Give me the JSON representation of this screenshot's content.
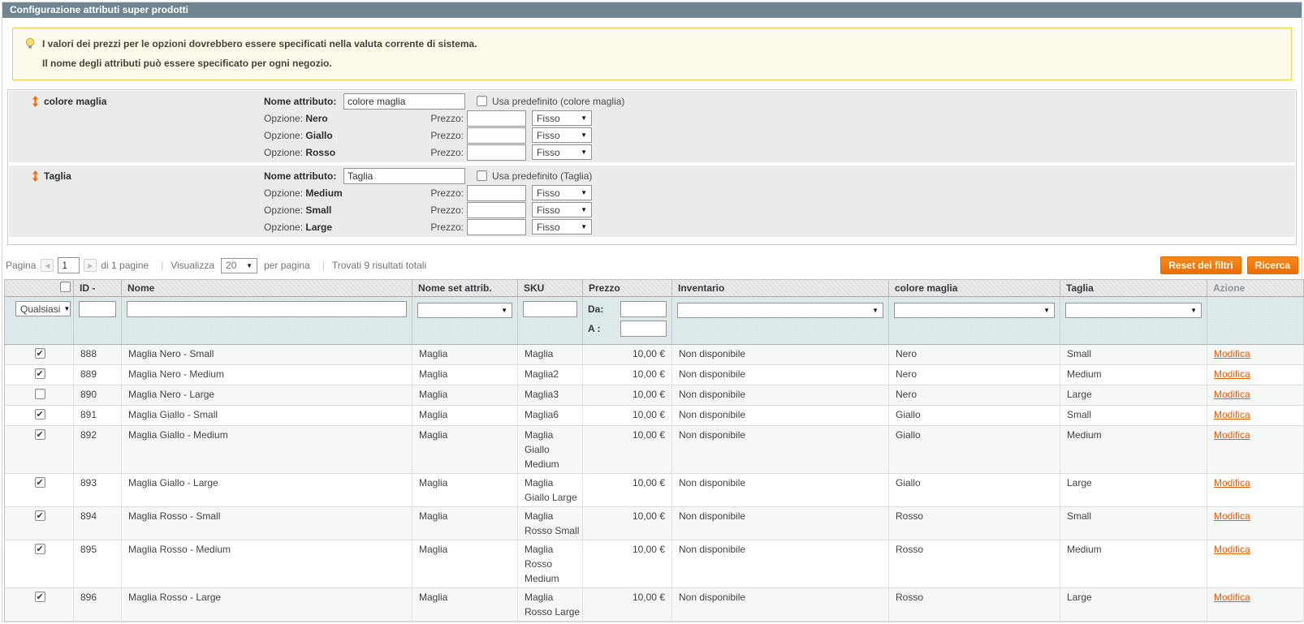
{
  "title": "Configurazione attributi super prodotti",
  "notice": {
    "line1": "I valori dei prezzi per le opzioni dovrebbero essere specificati nella valuta corrente di sistema.",
    "line2": "Il nome degli attributi può essere specificato per ogni negozio."
  },
  "attributes": [
    {
      "label": "colore maglia",
      "name_label": "Nome attributo:",
      "name_value": "colore maglia",
      "use_default_label": "Usa predefinito (colore maglia)",
      "use_default_checked": false,
      "option_label": "Opzione:",
      "price_label": "Prezzo:",
      "options": [
        {
          "name": "Nero",
          "price": "",
          "price_type": "Fisso"
        },
        {
          "name": "Giallo",
          "price": "",
          "price_type": "Fisso"
        },
        {
          "name": "Rosso",
          "price": "",
          "price_type": "Fisso"
        }
      ]
    },
    {
      "label": "Taglia",
      "name_label": "Nome attributo:",
      "name_value": "Taglia",
      "use_default_label": "Usa predefinito (Taglia)",
      "use_default_checked": false,
      "option_label": "Opzione:",
      "price_label": "Prezzo:",
      "options": [
        {
          "name": "Medium",
          "price": "",
          "price_type": "Fisso"
        },
        {
          "name": "Small",
          "price": "",
          "price_type": "Fisso"
        },
        {
          "name": "Large",
          "price": "",
          "price_type": "Fisso"
        }
      ]
    }
  ],
  "toolbar": {
    "page_label": "Pagina",
    "page_value": "1",
    "pages_total_label": "di 1 pagine",
    "view_label": "Visualizza",
    "per_page_value": "20",
    "per_page_label": "per pagina",
    "results_label": "Trovati 9 risultati totali",
    "reset_button": "Reset dei filtri",
    "search_button": "Ricerca"
  },
  "grid": {
    "columns": [
      "",
      "ID -",
      "Nome",
      "Nome set attrib.",
      "SKU",
      "Prezzo",
      "Inventario",
      "colore maglia",
      "Taglia",
      "Azione"
    ],
    "filters": {
      "massaction_value": "Qualsiasi",
      "price_from_label": "Da:",
      "price_to_label": "A :"
    },
    "rows": [
      {
        "checked": true,
        "id": "888",
        "nome": "Maglia Nero - Small",
        "set": "Maglia",
        "sku": "Maglia",
        "prezzo": "10,00 €",
        "inventario": "Non disponibile",
        "colore": "Nero",
        "taglia": "Small",
        "azione": "Modifica"
      },
      {
        "checked": true,
        "id": "889",
        "nome": "Maglia Nero - Medium",
        "set": "Maglia",
        "sku": "Maglia2",
        "prezzo": "10,00 €",
        "inventario": "Non disponibile",
        "colore": "Nero",
        "taglia": "Medium",
        "azione": "Modifica"
      },
      {
        "checked": false,
        "id": "890",
        "nome": "Maglia Nero - Large",
        "set": "Maglia",
        "sku": "Maglia3",
        "prezzo": "10,00 €",
        "inventario": "Non disponibile",
        "colore": "Nero",
        "taglia": "Large",
        "azione": "Modifica"
      },
      {
        "checked": true,
        "id": "891",
        "nome": "Maglia Giallo - Small",
        "set": "Maglia",
        "sku": "Maglia6",
        "prezzo": "10,00 €",
        "inventario": "Non disponibile",
        "colore": "Giallo",
        "taglia": "Small",
        "azione": "Modifica"
      },
      {
        "checked": true,
        "id": "892",
        "nome": "Maglia Giallo - Medium",
        "set": "Maglia",
        "sku": "Maglia Giallo Medium",
        "prezzo": "10,00 €",
        "inventario": "Non disponibile",
        "colore": "Giallo",
        "taglia": "Medium",
        "azione": "Modifica"
      },
      {
        "checked": true,
        "id": "893",
        "nome": "Maglia Giallo - Large",
        "set": "Maglia",
        "sku": "Maglia Giallo Large",
        "prezzo": "10,00 €",
        "inventario": "Non disponibile",
        "colore": "Giallo",
        "taglia": "Large",
        "azione": "Modifica"
      },
      {
        "checked": true,
        "id": "894",
        "nome": "Maglia Rosso - Small",
        "set": "Maglia",
        "sku": "Maglia Rosso Small",
        "prezzo": "10,00 €",
        "inventario": "Non disponibile",
        "colore": "Rosso",
        "taglia": "Small",
        "azione": "Modifica"
      },
      {
        "checked": true,
        "id": "895",
        "nome": "Maglia Rosso - Medium",
        "set": "Maglia",
        "sku": "Maglia Rosso Medium",
        "prezzo": "10,00 €",
        "inventario": "Non disponibile",
        "colore": "Rosso",
        "taglia": "Medium",
        "azione": "Modifica"
      },
      {
        "checked": true,
        "id": "896",
        "nome": "Maglia Rosso - Large",
        "set": "Maglia",
        "sku": "Maglia Rosso Large",
        "prezzo": "10,00 €",
        "inventario": "Non disponibile",
        "colore": "Rosso",
        "taglia": "Large",
        "azione": "Modifica"
      }
    ]
  },
  "colors": {
    "title_bar": "#6f8591",
    "accent_orange": "#f18000",
    "link_orange": "#e85d06",
    "notice_bg": "#fffbec",
    "notice_border": "#f2ce4e",
    "filter_row_bg": "#dce8e8"
  },
  "icons": {
    "notice": "lightbulb-icon",
    "attribute_drag": "drag-handle-icon",
    "select_arrow": "▾",
    "pager_prev": "◄",
    "pager_next": "►",
    "check": "✔"
  }
}
